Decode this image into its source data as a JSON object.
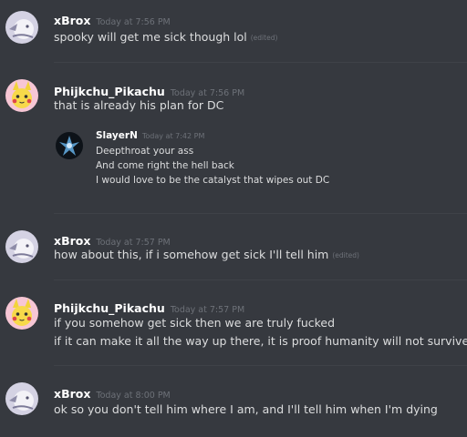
{
  "messages": [
    {
      "author": "xBrox",
      "timestamp": "Today at 7:56 PM",
      "avatar": "xbrox-avatar",
      "lines": [
        "spooky will get me sick though lol"
      ],
      "edited_label": "(edited)"
    },
    {
      "author": "Phijkchu_Pikachu",
      "timestamp": "Today at 7:56 PM",
      "avatar": "pikachu-avatar",
      "lines": [
        "that is already his plan for DC"
      ],
      "embed": {
        "author": "SlayerN",
        "timestamp": "Today at 7:42 PM",
        "avatar": "slayern-avatar",
        "lines": [
          "Deepthroat your ass",
          "And come right the hell back",
          "I would love to be the catalyst that wipes out DC"
        ]
      }
    },
    {
      "author": "xBrox",
      "timestamp": "Today at 7:57 PM",
      "avatar": "xbrox-avatar",
      "lines": [
        "how about this, if i somehow get sick I'll tell him"
      ],
      "edited_label": "(edited)"
    },
    {
      "author": "Phijkchu_Pikachu",
      "timestamp": "Today at 7:57 PM",
      "avatar": "pikachu-avatar",
      "lines": [
        "if you somehow get sick then we are truly fucked",
        "if it can make it all the way up there, it is proof humanity will not survive"
      ]
    },
    {
      "author": "xBrox",
      "timestamp": "Today at 8:00 PM",
      "avatar": "xbrox-avatar",
      "lines": [
        "ok so you don't tell him where I am, and I'll tell him when I'm dying"
      ]
    }
  ],
  "colors": {
    "background": "#36393f",
    "author": "#ffffff",
    "text": "#dcddde",
    "timestamp": "#6d7178",
    "divider": "#3f4248"
  }
}
